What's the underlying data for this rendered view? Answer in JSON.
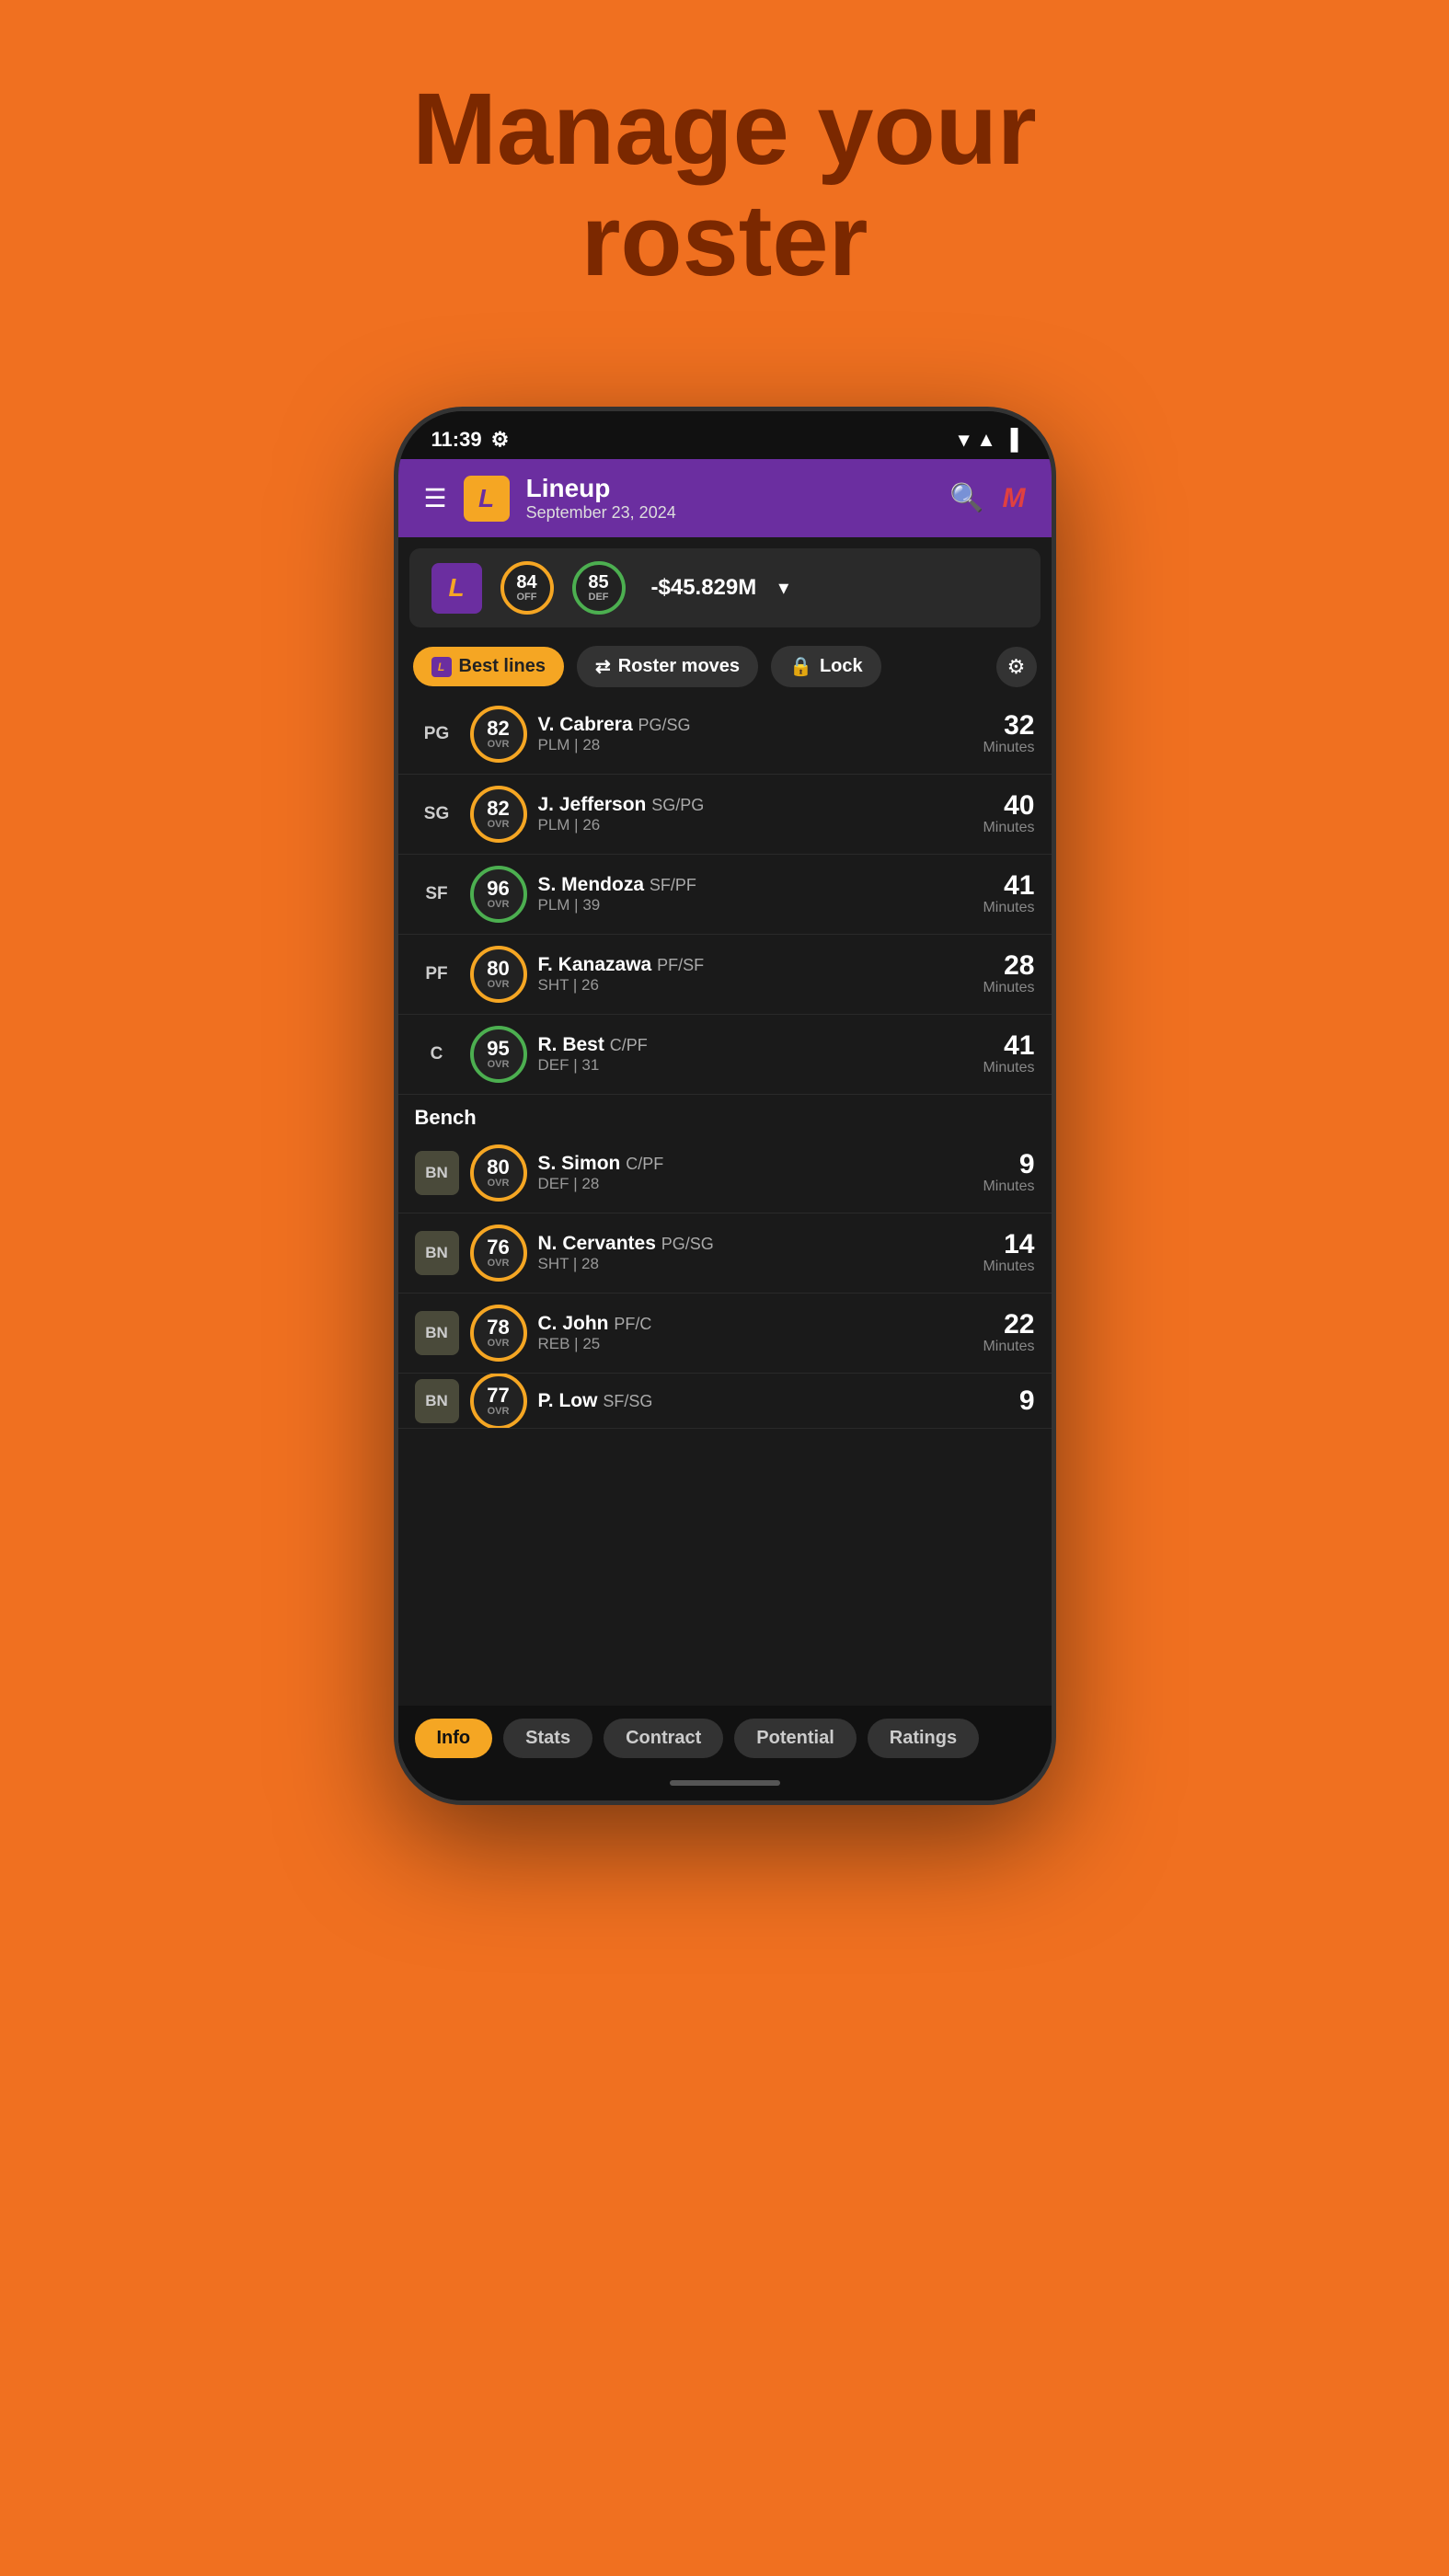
{
  "headline": {
    "line1": "Manage your",
    "line2": "roster"
  },
  "status_bar": {
    "time": "11:39",
    "settings_icon": "⚙",
    "wifi": "▲",
    "signal": "▲",
    "battery": "🔋"
  },
  "header": {
    "menu_icon": "☰",
    "team_logo": "L",
    "title": "Lineup",
    "subtitle": "September 23, 2024",
    "search_icon": "🔍",
    "profile_initial": "M"
  },
  "team_bar": {
    "logo": "L",
    "off_rating": "84",
    "off_label": "OFF",
    "def_rating": "85",
    "def_label": "DEF",
    "balance": "-$45.829M"
  },
  "actions": {
    "best_lines": "Best lines",
    "roster_moves": "Roster moves",
    "lock": "Lock",
    "gear": "⚙"
  },
  "starters": [
    {
      "position": "PG",
      "ovr": "82",
      "name": "V. Cabrera",
      "pos_detail": "PG/SG",
      "meta": "PLM | 28",
      "minutes": "32",
      "border_color": "#F5A623"
    },
    {
      "position": "SG",
      "ovr": "82",
      "name": "J. Jefferson",
      "pos_detail": "SG/PG",
      "meta": "PLM | 26",
      "minutes": "40",
      "border_color": "#F5A623"
    },
    {
      "position": "SF",
      "ovr": "96",
      "name": "S. Mendoza",
      "pos_detail": "SF/PF",
      "meta": "PLM | 39",
      "minutes": "41",
      "border_color": "#4CAF50"
    },
    {
      "position": "PF",
      "ovr": "80",
      "name": "F. Kanazawa",
      "pos_detail": "PF/SF",
      "meta": "SHT | 26",
      "minutes": "28",
      "border_color": "#F5A623"
    },
    {
      "position": "C",
      "ovr": "95",
      "name": "R. Best",
      "pos_detail": "C/PF",
      "meta": "DEF | 31",
      "minutes": "41",
      "border_color": "#4CAF50"
    }
  ],
  "bench_label": "Bench",
  "bench": [
    {
      "position": "BN",
      "ovr": "80",
      "name": "S. Simon",
      "pos_detail": "C/PF",
      "meta": "DEF | 28",
      "minutes": "9",
      "border_color": "#F5A623"
    },
    {
      "position": "BN",
      "ovr": "76",
      "name": "N. Cervantes",
      "pos_detail": "PG/SG",
      "meta": "SHT | 28",
      "minutes": "14",
      "border_color": "#F5A623"
    },
    {
      "position": "BN",
      "ovr": "78",
      "name": "C. John",
      "pos_detail": "PF/C",
      "meta": "REB | 25",
      "minutes": "22",
      "border_color": "#F5A623"
    },
    {
      "position": "BN",
      "ovr": "77",
      "name": "P. Low",
      "pos_detail": "SF/SG",
      "meta": "",
      "minutes": "9",
      "border_color": "#F5A623"
    }
  ],
  "tabs": [
    {
      "label": "Info",
      "active": true
    },
    {
      "label": "Stats",
      "active": false
    },
    {
      "label": "Contract",
      "active": false
    },
    {
      "label": "Potential",
      "active": false
    },
    {
      "label": "Ratings",
      "active": false
    }
  ]
}
